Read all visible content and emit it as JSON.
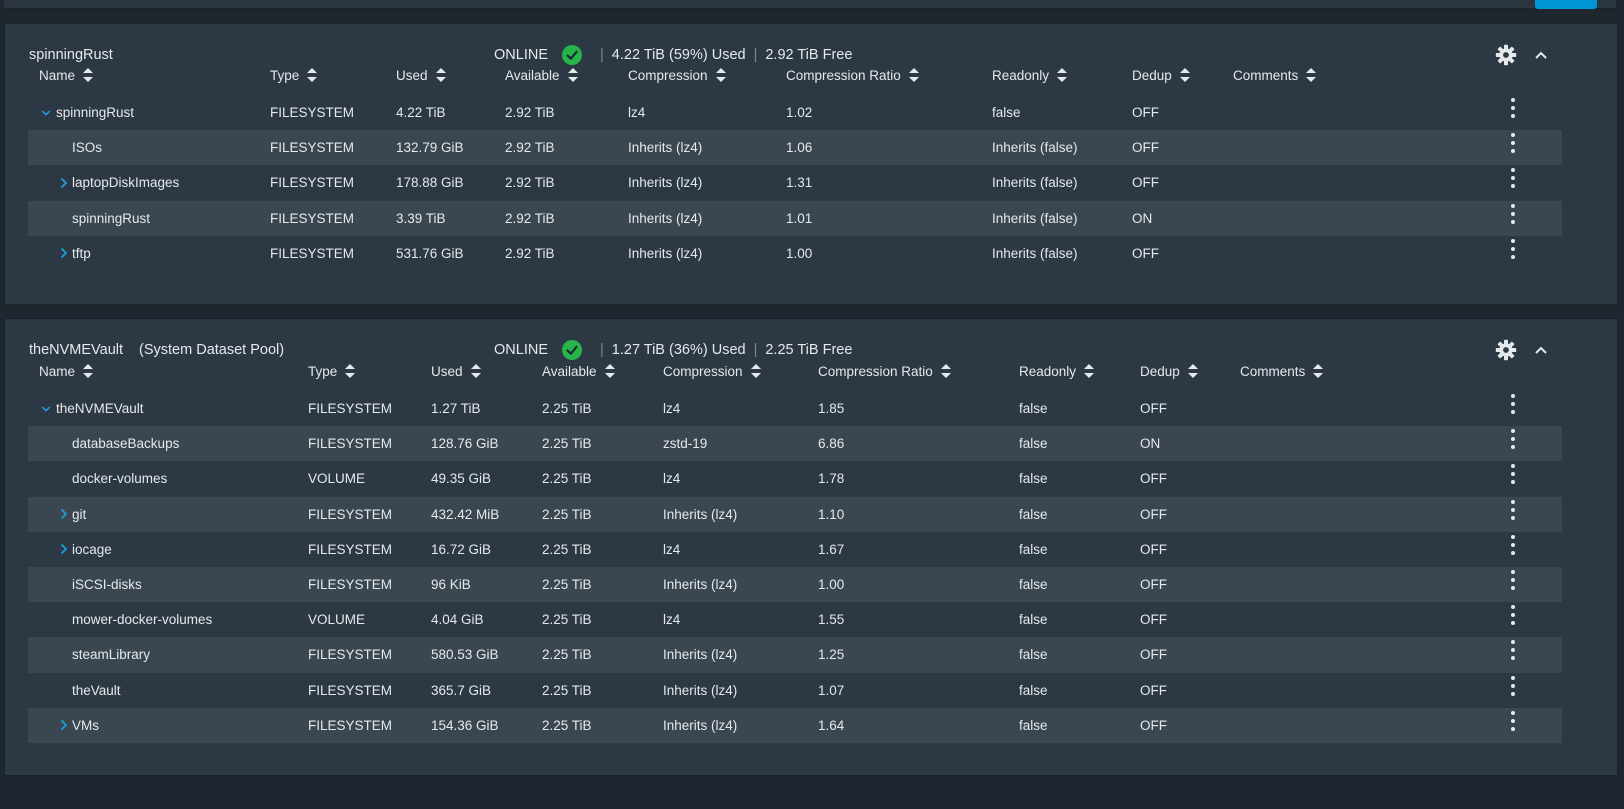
{
  "pools": [
    {
      "name": "spinningRust",
      "subtitle": "",
      "status": "ONLINE",
      "used_text": "4.22 TiB (59%) Used",
      "free_text": "2.92 TiB Free",
      "columns": [
        "Name",
        "Type",
        "Used",
        "Available",
        "Compression",
        "Compression Ratio",
        "Readonly",
        "Dedup",
        "Comments"
      ],
      "rows": [
        {
          "name": "spinningRust",
          "expander": "down",
          "type": "FILESYSTEM",
          "used": "4.22 TiB",
          "available": "2.92 TiB",
          "compression": "lz4",
          "ratio": "1.02",
          "readonly": "false",
          "dedup": "OFF",
          "comments": ""
        },
        {
          "name": "ISOs",
          "expander": "none",
          "type": "FILESYSTEM",
          "used": "132.79 GiB",
          "available": "2.92 TiB",
          "compression": "Inherits (lz4)",
          "ratio": "1.06",
          "readonly": "Inherits (false)",
          "dedup": "OFF",
          "comments": ""
        },
        {
          "name": "laptopDiskImages",
          "expander": "right",
          "type": "FILESYSTEM",
          "used": "178.88 GiB",
          "available": "2.92 TiB",
          "compression": "Inherits (lz4)",
          "ratio": "1.31",
          "readonly": "Inherits (false)",
          "dedup": "OFF",
          "comments": ""
        },
        {
          "name": "spinningRust",
          "expander": "none",
          "type": "FILESYSTEM",
          "used": "3.39 TiB",
          "available": "2.92 TiB",
          "compression": "Inherits (lz4)",
          "ratio": "1.01",
          "readonly": "Inherits (false)",
          "dedup": "ON",
          "comments": ""
        },
        {
          "name": "tftp",
          "expander": "right",
          "type": "FILESYSTEM",
          "used": "531.76 GiB",
          "available": "2.92 TiB",
          "compression": "Inherits (lz4)",
          "ratio": "1.00",
          "readonly": "Inherits (false)",
          "dedup": "OFF",
          "comments": ""
        }
      ]
    },
    {
      "name": "theNVMEVault",
      "subtitle": "(System Dataset Pool)",
      "status": "ONLINE",
      "used_text": "1.27 TiB (36%) Used",
      "free_text": "2.25 TiB Free",
      "columns": [
        "Name",
        "Type",
        "Used",
        "Available",
        "Compression",
        "Compression Ratio",
        "Readonly",
        "Dedup",
        "Comments"
      ],
      "rows": [
        {
          "name": "theNVMEVault",
          "expander": "down",
          "type": "FILESYSTEM",
          "used": "1.27 TiB",
          "available": "2.25 TiB",
          "compression": "lz4",
          "ratio": "1.85",
          "readonly": "false",
          "dedup": "OFF",
          "comments": ""
        },
        {
          "name": "databaseBackups",
          "expander": "none",
          "type": "FILESYSTEM",
          "used": "128.76 GiB",
          "available": "2.25 TiB",
          "compression": "zstd-19",
          "ratio": "6.86",
          "readonly": "false",
          "dedup": "ON",
          "comments": ""
        },
        {
          "name": "docker-volumes",
          "expander": "none",
          "type": "VOLUME",
          "used": "49.35 GiB",
          "available": "2.25 TiB",
          "compression": "lz4",
          "ratio": "1.78",
          "readonly": "false",
          "dedup": "OFF",
          "comments": ""
        },
        {
          "name": "git",
          "expander": "right",
          "type": "FILESYSTEM",
          "used": "432.42 MiB",
          "available": "2.25 TiB",
          "compression": "Inherits (lz4)",
          "ratio": "1.10",
          "readonly": "false",
          "dedup": "OFF",
          "comments": ""
        },
        {
          "name": "iocage",
          "expander": "right",
          "type": "FILESYSTEM",
          "used": "16.72 GiB",
          "available": "2.25 TiB",
          "compression": "lz4",
          "ratio": "1.67",
          "readonly": "false",
          "dedup": "OFF",
          "comments": ""
        },
        {
          "name": "iSCSI-disks",
          "expander": "none",
          "type": "FILESYSTEM",
          "used": "96 KiB",
          "available": "2.25 TiB",
          "compression": "Inherits (lz4)",
          "ratio": "1.00",
          "readonly": "false",
          "dedup": "OFF",
          "comments": ""
        },
        {
          "name": "mower-docker-volumes",
          "expander": "none",
          "type": "VOLUME",
          "used": "4.04 GiB",
          "available": "2.25 TiB",
          "compression": "lz4",
          "ratio": "1.55",
          "readonly": "false",
          "dedup": "OFF",
          "comments": ""
        },
        {
          "name": "steamLibrary",
          "expander": "none",
          "type": "FILESYSTEM",
          "used": "580.53 GiB",
          "available": "2.25 TiB",
          "compression": "Inherits (lz4)",
          "ratio": "1.25",
          "readonly": "false",
          "dedup": "OFF",
          "comments": ""
        },
        {
          "name": "theVault",
          "expander": "none",
          "type": "FILESYSTEM",
          "used": "365.7 GiB",
          "available": "2.25 TiB",
          "compression": "Inherits (lz4)",
          "ratio": "1.07",
          "readonly": "false",
          "dedup": "OFF",
          "comments": ""
        },
        {
          "name": "VMs",
          "expander": "right",
          "type": "FILESYSTEM",
          "used": "154.36 GiB",
          "available": "2.25 TiB",
          "compression": "Inherits (lz4)",
          "ratio": "1.64",
          "readonly": "false",
          "dedup": "OFF",
          "comments": ""
        }
      ]
    }
  ],
  "icons": {
    "settings": "gear-icon",
    "collapse": "chevron-up-icon",
    "row_actions": "more-vert-icon",
    "expand_open": "chevron-down-icon",
    "expand_closed": "chevron-right-icon",
    "status_ok": "check-circle-icon"
  },
  "colors": {
    "background": "#1e2730",
    "card": "#2c3843",
    "row_alt": "#3a4650",
    "online_green": "#27b44a",
    "accent_blue": "#0095d5"
  }
}
